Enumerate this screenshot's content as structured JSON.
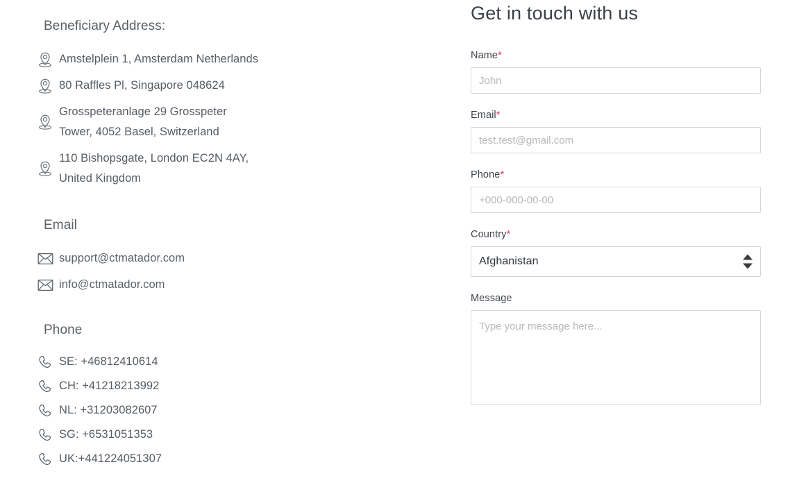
{
  "contact": {
    "address_heading": "Beneficiary Address:",
    "addresses": [
      {
        "icon": "map-pin-icon",
        "text": "Amstelplein 1, Amsterdam Netherlands"
      },
      {
        "icon": "map-pin-icon",
        "text": "80 Raffles Pl, Singapore 048624"
      },
      {
        "icon": "map-pin-icon",
        "text": "Grosspeteranlage 29 Grosspeter\nTower, 4052 Basel, Switzerland"
      },
      {
        "icon": "map-pin-icon",
        "text": "110 Bishopsgate, London EC2N 4AY,\nUnited Kingdom"
      }
    ],
    "email_heading": "Email",
    "emails": [
      {
        "icon": "envelope-icon",
        "text": "support@ctmatador.com"
      },
      {
        "icon": "envelope-icon",
        "text": "info@ctmatador.com"
      }
    ],
    "phone_heading": "Phone",
    "phones": [
      {
        "icon": "phone-handset-icon",
        "text": "SE: +46812410614"
      },
      {
        "icon": "phone-handset-icon",
        "text": "CH: +41218213992"
      },
      {
        "icon": "phone-handset-icon",
        "text": "NL: +31203082607"
      },
      {
        "icon": "phone-handset-icon",
        "text": "SG: +6531051353"
      },
      {
        "icon": "phone-handset-icon",
        "text": "UK:+441224051307"
      }
    ]
  },
  "form": {
    "title": "Get in touch with us",
    "required_marker": "*",
    "name": {
      "label": "Name",
      "required": true,
      "value": "",
      "placeholder": "John"
    },
    "email": {
      "label": "Email",
      "required": true,
      "value": "",
      "placeholder": "test.test@gmail.com"
    },
    "phone": {
      "label": "Phone",
      "required": true,
      "value": "",
      "placeholder": "+000-000-00-00"
    },
    "country": {
      "label": "Country",
      "required": true,
      "selected": "Afghanistan"
    },
    "message": {
      "label": "Message",
      "required": false,
      "value": "",
      "placeholder": "Type your message here..."
    }
  },
  "colors": {
    "required_star": "#e5335f",
    "body_text": "#565c63",
    "heading_text": "#3c4148",
    "field_border": "#d6d6d6",
    "placeholder": "#b8b8b8"
  }
}
